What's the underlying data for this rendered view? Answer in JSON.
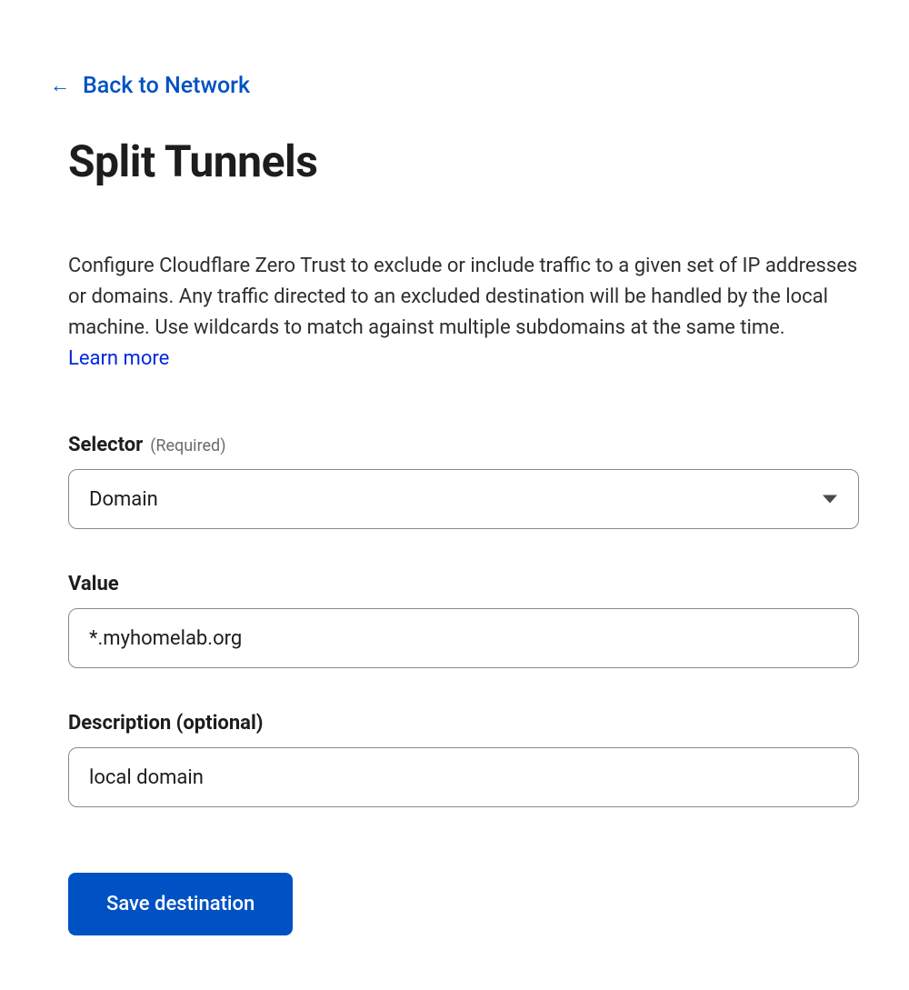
{
  "nav": {
    "back_label": "Back to Network"
  },
  "header": {
    "title": "Split Tunnels"
  },
  "intro": {
    "description": "Configure Cloudflare Zero Trust to exclude or include traffic to a given set of IP addresses or domains. Any traffic directed to an excluded destination will be handled by the local machine. Use wildcards to match against multiple subdomains at the same time.",
    "learn_more": "Learn more"
  },
  "form": {
    "selector": {
      "label": "Selector",
      "required_hint": "(Required)",
      "value": "Domain"
    },
    "value_field": {
      "label": "Value",
      "value": "*.myhomelab.org"
    },
    "description_field": {
      "label": "Description (optional)",
      "value": "local domain"
    },
    "save_button": "Save destination"
  }
}
